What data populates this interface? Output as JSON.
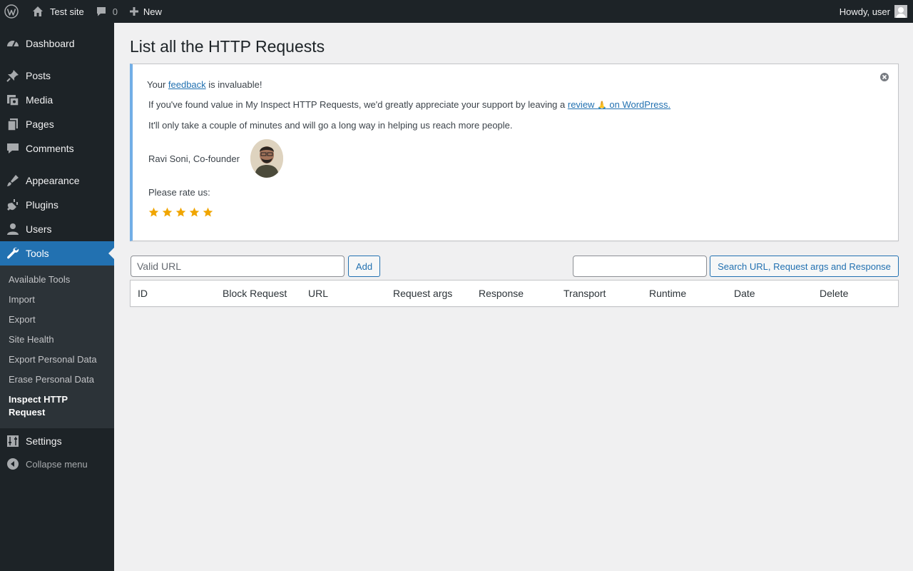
{
  "adminbar": {
    "site_name": "Test site",
    "comments_count": "0",
    "new_label": "New",
    "howdy": "Howdy, user"
  },
  "sidebar": {
    "items": [
      {
        "label": "Dashboard",
        "icon": "dashboard-icon"
      },
      {
        "label": "Posts",
        "icon": "pin-icon"
      },
      {
        "label": "Media",
        "icon": "media-icon"
      },
      {
        "label": "Pages",
        "icon": "pages-icon"
      },
      {
        "label": "Comments",
        "icon": "comment-icon"
      },
      {
        "label": "Appearance",
        "icon": "brush-icon"
      },
      {
        "label": "Plugins",
        "icon": "plug-icon"
      },
      {
        "label": "Users",
        "icon": "user-icon"
      },
      {
        "label": "Tools",
        "icon": "wrench-icon"
      },
      {
        "label": "Settings",
        "icon": "sliders-icon"
      }
    ],
    "tools_submenu": [
      "Available Tools",
      "Import",
      "Export",
      "Site Health",
      "Export Personal Data",
      "Erase Personal Data",
      "Inspect HTTP Request"
    ],
    "collapse_label": "Collapse menu"
  },
  "main": {
    "title": "List all the HTTP Requests",
    "notice": {
      "line1_pre": "Your ",
      "line1_link": "feedback",
      "line1_post": " is invaluable!",
      "line2_pre": "If you've found value in My Inspect HTTP Requests, we'd greatly appreciate your support by leaving a ",
      "line2_link1": "review ",
      "line2_emoji": "🙏",
      "line2_link2": " on WordPress.",
      "line3": "It'll only take a couple of minutes and will go a long way in helping us reach more people.",
      "signature": "Ravi Soni, Co-founder",
      "rate_label": "Please rate us:",
      "stars": 5
    },
    "url_placeholder": "Valid URL",
    "add_label": "Add",
    "search_value": "",
    "search_button": "Search URL, Request args and Response",
    "table_headers": [
      "ID",
      "Block Request",
      "URL",
      "Request args",
      "Response",
      "Transport",
      "Runtime",
      "Date",
      "Delete"
    ]
  },
  "colors": {
    "accent": "#2271b1",
    "sidebar_bg": "#1d2327",
    "notice_border": "#72aee6",
    "star": "#f0a500"
  }
}
